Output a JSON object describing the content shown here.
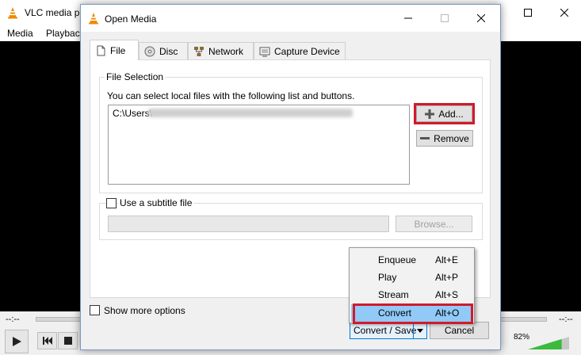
{
  "vlc": {
    "title": "VLC media pl",
    "menu": [
      "Media",
      "Playback"
    ],
    "time_elapsed": "--:--",
    "time_total": "--:--",
    "volume": "82%",
    "volume_level": 0.82
  },
  "dialog": {
    "title": "Open Media",
    "tabs": [
      {
        "label": "File",
        "icon": "file-icon",
        "active": true
      },
      {
        "label": "Disc",
        "icon": "disc-icon",
        "active": false
      },
      {
        "label": "Network",
        "icon": "network-icon",
        "active": false
      },
      {
        "label": "Capture Device",
        "icon": "capture-device-icon",
        "active": false
      }
    ],
    "file_selection": {
      "group_label": "File Selection",
      "hint": "You can select local files with the following list and buttons.",
      "file_path_prefix": "C:\\Users\\",
      "add_label": "Add...",
      "remove_label": "Remove"
    },
    "subtitle": {
      "checkbox_label": "Use a subtitle file",
      "checked": false,
      "browse_label": "Browse..."
    },
    "show_more_label": "Show more options",
    "convert_save_label": "Convert / Save",
    "cancel_label": "Cancel",
    "dropdown": [
      {
        "label": "Enqueue",
        "shortcut": "Alt+E",
        "selected": false
      },
      {
        "label": "Play",
        "shortcut": "Alt+P",
        "selected": false
      },
      {
        "label": "Stream",
        "shortcut": "Alt+S",
        "selected": false
      },
      {
        "label": "Convert",
        "shortcut": "Alt+O",
        "selected": true
      }
    ]
  },
  "colors": {
    "highlight": "#d11a2a",
    "accent": "#0078d7",
    "selected_item": "#91c9f7",
    "vlc_orange": "#f08a00"
  }
}
